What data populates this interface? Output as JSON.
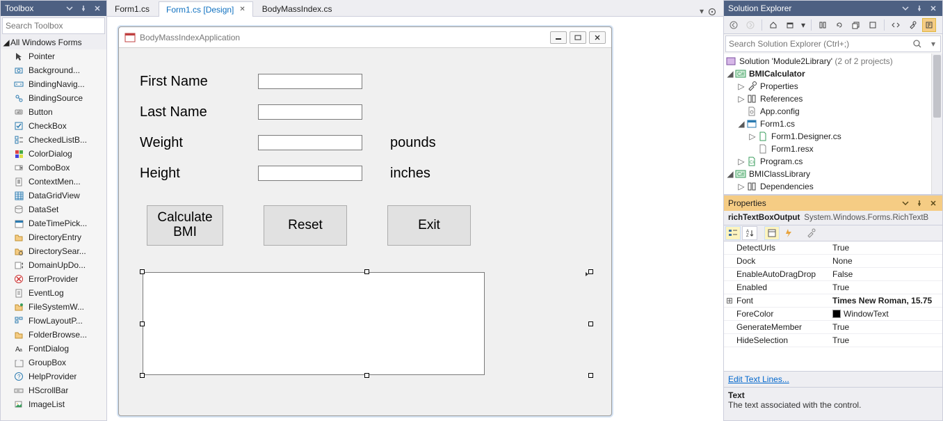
{
  "toolbox": {
    "title": "Toolbox",
    "search_placeholder": "Search Toolbox",
    "group": "All Windows Forms",
    "items": [
      {
        "icon": "pointer",
        "label": "Pointer"
      },
      {
        "icon": "bgworker",
        "label": "Background..."
      },
      {
        "icon": "bindnav",
        "label": "BindingNavig..."
      },
      {
        "icon": "bindsrc",
        "label": "BindingSource"
      },
      {
        "icon": "button",
        "label": "Button"
      },
      {
        "icon": "checkbox",
        "label": "CheckBox"
      },
      {
        "icon": "checklist",
        "label": "CheckedListB..."
      },
      {
        "icon": "colordlg",
        "label": "ColorDialog"
      },
      {
        "icon": "combobox",
        "label": "ComboBox"
      },
      {
        "icon": "ctxmenu",
        "label": "ContextMen..."
      },
      {
        "icon": "datagrid",
        "label": "DataGridView"
      },
      {
        "icon": "dataset",
        "label": "DataSet"
      },
      {
        "icon": "datetime",
        "label": "DateTimePick..."
      },
      {
        "icon": "direntry",
        "label": "DirectoryEntry"
      },
      {
        "icon": "dirsearch",
        "label": "DirectorySear..."
      },
      {
        "icon": "domainud",
        "label": "DomainUpDo..."
      },
      {
        "icon": "errorprov",
        "label": "ErrorProvider"
      },
      {
        "icon": "eventlog",
        "label": "EventLog"
      },
      {
        "icon": "fswatch",
        "label": "FileSystemW..."
      },
      {
        "icon": "flowlayout",
        "label": "FlowLayoutP..."
      },
      {
        "icon": "folderbrowse",
        "label": "FolderBrowse..."
      },
      {
        "icon": "fontdlg",
        "label": "FontDialog"
      },
      {
        "icon": "groupbox",
        "label": "GroupBox"
      },
      {
        "icon": "helpprov",
        "label": "HelpProvider"
      },
      {
        "icon": "hscroll",
        "label": "HScrollBar"
      },
      {
        "icon": "imagelist",
        "label": "ImageList"
      }
    ]
  },
  "tabs": {
    "items": [
      {
        "label": "Form1.cs",
        "active": false
      },
      {
        "label": "Form1.cs [Design]",
        "active": true
      },
      {
        "label": "BodyMassIndex.cs",
        "active": false
      }
    ]
  },
  "designer": {
    "form_title": "BodyMassIndexApplication",
    "labels": {
      "first_name": "First Name",
      "last_name": "Last Name",
      "weight": "Weight",
      "height": "Height",
      "pounds": "pounds",
      "inches": "inches"
    },
    "buttons": {
      "calc": "Calculate BMI",
      "reset": "Reset",
      "exit": "Exit"
    }
  },
  "solution_explorer": {
    "title": "Solution Explorer",
    "search_placeholder": "Search Solution Explorer (Ctrl+;)",
    "solution_line_a": "Solution 'Module2Library'",
    "solution_line_b": "(2 of 2 projects)",
    "tree": {
      "project1": "BMICalculator",
      "properties": "Properties",
      "references": "References",
      "appconfig": "App.config",
      "form1": "Form1.cs",
      "form1designer": "Form1.Designer.cs",
      "form1resx": "Form1.resx",
      "program": "Program.cs",
      "project2": "BMIClassLibrary",
      "deps": "Dependencies"
    }
  },
  "properties": {
    "title": "Properties",
    "object_name": "richTextBoxOutput",
    "object_type": "System.Windows.Forms.RichTextB",
    "rows": [
      {
        "name": "DetectUrls",
        "value": "True"
      },
      {
        "name": "Dock",
        "value": "None"
      },
      {
        "name": "EnableAutoDragDrop",
        "value": "False"
      },
      {
        "name": "Enabled",
        "value": "True"
      },
      {
        "name": "Font",
        "value": "Times New Roman, 15.75",
        "expand": true,
        "bold": true
      },
      {
        "name": "ForeColor",
        "value": "WindowText",
        "swatch": true
      },
      {
        "name": "GenerateMember",
        "value": "True"
      },
      {
        "name": "HideSelection",
        "value": "True"
      }
    ],
    "link": "Edit Text Lines...",
    "desc_title": "Text",
    "desc_text": "The text associated with the control."
  }
}
